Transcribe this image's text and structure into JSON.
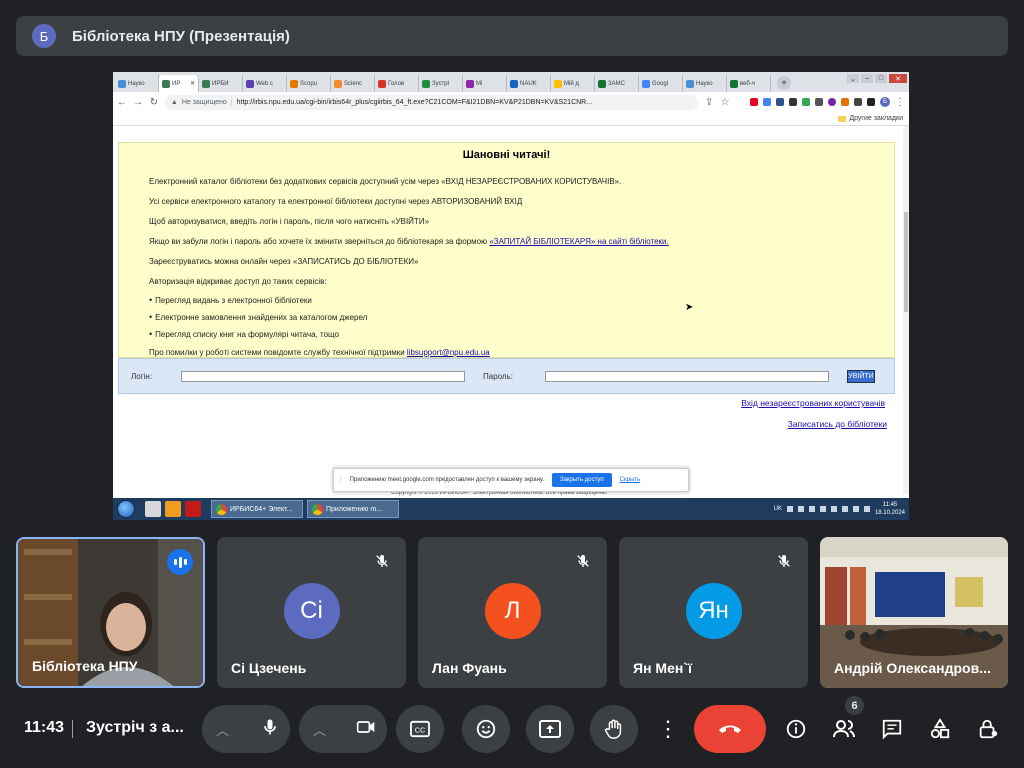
{
  "presenter": {
    "avatar_letter": "Б",
    "title": "Бібліотека НПУ (Презентація)"
  },
  "browser": {
    "tabs": [
      {
        "label": "Науко",
        "color": "#4a90d9"
      },
      {
        "label": "ИР",
        "color": "#3b7a57",
        "active": true
      },
      {
        "label": "ИРБИ",
        "color": "#3b7a57"
      },
      {
        "label": "Web c",
        "color": "#5a3fb0"
      },
      {
        "label": "Scopu",
        "color": "#e07b00"
      },
      {
        "label": "Scienc",
        "color": "#f28b30"
      },
      {
        "label": "Голов",
        "color": "#d93025"
      },
      {
        "label": "Зустрі",
        "color": "#1e8e3e"
      },
      {
        "label": "Мі",
        "color": "#8e24aa"
      },
      {
        "label": "NAUK",
        "color": "#1565c0"
      },
      {
        "label": "Мій д",
        "color": "#fbbc04"
      },
      {
        "label": "ЗАМС",
        "color": "#137333"
      },
      {
        "label": "Googl",
        "color": "#4285f4"
      },
      {
        "label": "Науко",
        "color": "#4a90d9"
      },
      {
        "label": "веб-ч",
        "color": "#137333"
      }
    ],
    "new_tab": "+",
    "nav": {
      "back": "←",
      "forward": "→",
      "reload": "↻"
    },
    "insecure_label": "Не защищено",
    "url": "http://irbis.npu.edu.ua/cgi-bin/irbis64r_plus/cgiirbis_64_ft.exe?C21COM=F&I21DBN=KV&P21DBN=KV&S21CNR...",
    "profile_letter": "Б",
    "bookmarks_label": "Другие закладки"
  },
  "page": {
    "title": "Шановні читачі!",
    "paragraphs": {
      "p1": "Електронний каталог бібліотеки без додаткових сервісів доступний усім через «ВХІД НЕЗАРЕЄСТРОВАНИХ КОРИСТУВАЧІВ».",
      "p2": "Усі сервіси електронного каталогу та електронної бібліотеки доступні через АВТОРИЗОВАНИЙ ВХІД",
      "p3": "Щоб авторизуватися, введіть логін і пароль, після чого натисніть «УВІЙТИ»",
      "p4_text": "Якщо ви забули логін і пароль або хочете їх змінити зверніться до бібліотекаря за формою ",
      "p4_link": "«ЗАПИТАЙ БІБЛІОТЕКАРЯ» на сайті бібліотеки.",
      "p5": "Зареєструватись можна онлайн через «ЗАПИСАТИСЬ ДО БІБЛІОТЕКИ»",
      "p6": "Авторизація відкриває доступ до таких сервісів:",
      "p7_text": "Про помилки у роботі системи повідомте службу технічної підтримки ",
      "p7_link": "libsupport@npu.edu.ua"
    },
    "services": [
      "Перегляд видань з електронної бібліотеки",
      "Електронне замовлення знайдених за каталогом джерел",
      "Перегляд списку книг на формулярі читача, тощо"
    ],
    "login_label": "Логін:",
    "password_label": "Пароль:",
    "login_button": "УВІЙТИ",
    "unregistered_link": "Вхід незареєстрованих користувачів",
    "register_link": "Записатись до бібліотеки",
    "copyright": "Copyright © 2016 ИРБИС64+ Электронная библиотека. Все права защищены."
  },
  "share_bar": {
    "text": "Приложению meet.google.com предоставлен доступ к вашему экрану.",
    "stop": "Закрыть доступ",
    "hide": "Скрыть"
  },
  "taskbar": {
    "tasks": [
      "ИРБИС64+ Элект...",
      "Приложению m..."
    ],
    "lang": "UK",
    "clock_time": "11:45",
    "clock_date": "18.10.2024"
  },
  "participants": [
    {
      "name": "Бібліотека НПУ",
      "type": "video",
      "speaking": true
    },
    {
      "name": "Сі Цзечень",
      "initials": "Сі",
      "color": "#5c6bc0",
      "muted": true
    },
    {
      "name": "Лан Фуань",
      "initials": "Л",
      "color": "#f4511e",
      "muted": true
    },
    {
      "name": "Ян Мен`ї",
      "initials": "Ян",
      "color": "#039be5",
      "muted": true
    },
    {
      "name": "Андрій Олександров...",
      "type": "video"
    }
  ],
  "meeting": {
    "time": "11:43",
    "name": "Зустріч з а...",
    "people_count": "6"
  },
  "colors": {
    "background": "#202124",
    "surface": "#3c4043",
    "hangup": "#ea4335",
    "accent": "#1a73e8"
  }
}
